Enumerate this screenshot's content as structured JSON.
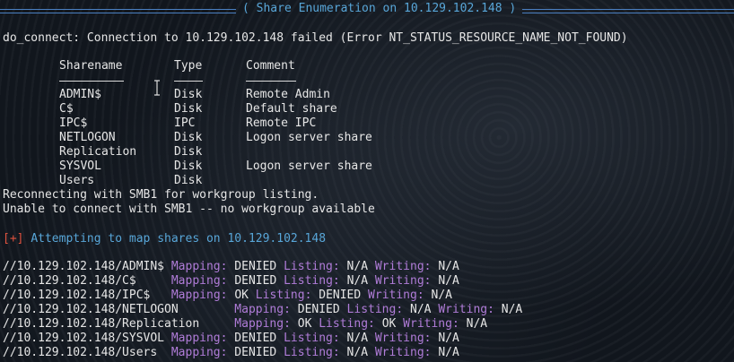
{
  "banner": {
    "title": "( Share Enumeration on 10.129.102.148 )"
  },
  "connect_error": "do_connect: Connection to 10.129.102.148 failed (Error NT_STATUS_RESOURCE_NAME_NOT_FOUND)",
  "share_table": {
    "headers": {
      "name": "Sharename",
      "type": "Type",
      "comment": "Comment"
    },
    "rows": [
      {
        "name": "ADMIN$",
        "type": "Disk",
        "comment": "Remote Admin"
      },
      {
        "name": "C$",
        "type": "Disk",
        "comment": "Default share"
      },
      {
        "name": "IPC$",
        "type": "IPC",
        "comment": "Remote IPC"
      },
      {
        "name": "NETLOGON",
        "type": "Disk",
        "comment": "Logon server share"
      },
      {
        "name": "Replication",
        "type": "Disk",
        "comment": ""
      },
      {
        "name": "SYSVOL",
        "type": "Disk",
        "comment": "Logon server share"
      },
      {
        "name": "Users",
        "type": "Disk",
        "comment": ""
      }
    ]
  },
  "smb1": {
    "reconnect": "Reconnecting with SMB1 for workgroup listing.",
    "unable": "Unable to connect with SMB1 -- no workgroup available"
  },
  "attempt": {
    "marker": "[+]",
    "text": "Attempting to map shares on 10.129.102.148"
  },
  "mapping": {
    "labels": {
      "mapping": "Mapping:",
      "listing": "Listing:",
      "writing": "Writing:"
    },
    "rows": [
      {
        "path": "//10.129.102.148/ADMIN$",
        "pad": " ",
        "mapping": "DENIED",
        "listing": "N/A",
        "writing": "N/A"
      },
      {
        "path": "//10.129.102.148/C$",
        "pad": "     ",
        "mapping": "DENIED",
        "listing": "N/A",
        "writing": "N/A"
      },
      {
        "path": "//10.129.102.148/IPC$",
        "pad": "   ",
        "mapping": "OK",
        "listing": "DENIED",
        "writing": "N/A"
      },
      {
        "path": "//10.129.102.148/NETLOGON",
        "pad": "        ",
        "mapping": "DENIED",
        "listing": "N/A",
        "writing": "N/A"
      },
      {
        "path": "//10.129.102.148/Replication",
        "pad": "     ",
        "mapping": "OK",
        "listing": "OK",
        "writing": "N/A"
      },
      {
        "path": "//10.129.102.148/SYSVOL",
        "pad": " ",
        "mapping": "DENIED",
        "listing": "N/A",
        "writing": "N/A"
      },
      {
        "path": "//10.129.102.148/Users",
        "pad": "  ",
        "mapping": "DENIED",
        "listing": "N/A",
        "writing": "N/A"
      }
    ]
  },
  "colors": {
    "banner": "#58a6d8",
    "accent_red": "#e0533f",
    "label_purple": "#b07cd8",
    "text": "#e6e6e6"
  }
}
